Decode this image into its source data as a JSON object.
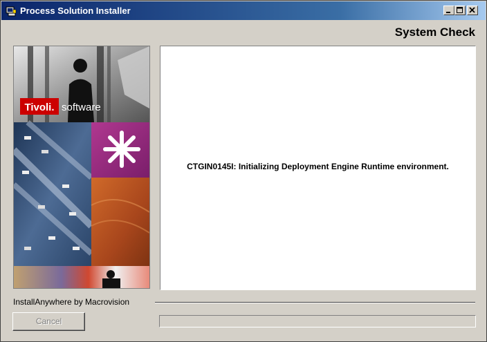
{
  "window": {
    "title": "Process Solution Installer",
    "icon": "installer-app-icon",
    "controls": [
      "minimize",
      "maximize",
      "close"
    ]
  },
  "header": {
    "heading": "System Check"
  },
  "side_image": {
    "description_icon": "tivoli-branding-collage",
    "logo_red": "Tivoli.",
    "logo_white": "software"
  },
  "main": {
    "status_message": "CTGIN0145I: Initializing Deployment Engine Runtime environment."
  },
  "footer": {
    "vendor_label": "InstallAnywhere by Macrovision",
    "cancel_label": "Cancel",
    "cancel_enabled": false,
    "progress": 0
  },
  "colors": {
    "titlebar_start": "#0a246a",
    "titlebar_end": "#a6caf0",
    "dialog_bg": "#d4d0c8",
    "tivoli_red": "#cc0000"
  }
}
